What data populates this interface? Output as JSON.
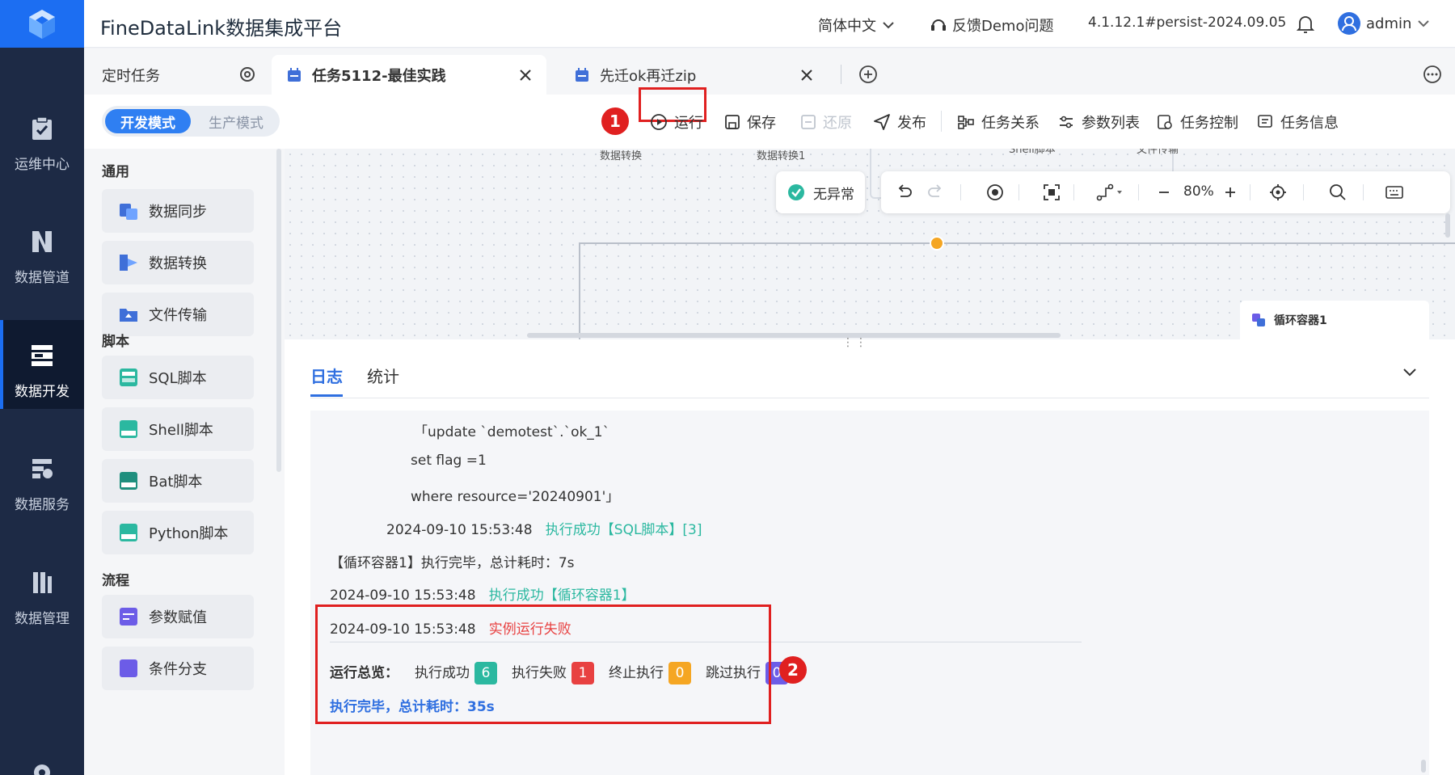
{
  "colors": {
    "nav_bg": "#1d2a45",
    "primary": "#1c6ef2",
    "success": "#2bb8a0",
    "error": "#e84141",
    "warn": "#f5a623",
    "purple": "#6c5ce7",
    "highlight": "#e02020"
  },
  "nav": {
    "items": [
      {
        "label": "运维中心",
        "icon": "clipboard-check-icon"
      },
      {
        "label": "数据管道",
        "icon": "pipeline-icon"
      },
      {
        "label": "数据开发",
        "icon": "dev-stack-icon"
      },
      {
        "label": "数据服务",
        "icon": "service-icon"
      },
      {
        "label": "数据管理",
        "icon": "manage-icon"
      }
    ]
  },
  "header": {
    "title": "FineDataLink数据集成平台",
    "language": "简体中文",
    "feedback": "反馈Demo问题",
    "version": "4.1.12.1#persist-2024.09.05",
    "user": "admin"
  },
  "tabs": {
    "scheduled": "定时任务",
    "tab1": "任务5112-最佳实践",
    "tab2": "先迁ok再迁zip"
  },
  "toolbar": {
    "mode_dev": "开发模式",
    "mode_prod": "生产模式",
    "run": "运行",
    "save": "保存",
    "restore": "还原",
    "publish": "发布",
    "relations": "任务关系",
    "params": "参数列表",
    "control": "任务控制",
    "info": "任务信息"
  },
  "sidebar": {
    "group_general": "通用",
    "group_script": "脚本",
    "group_flow": "流程",
    "items": [
      "数据同步",
      "数据转换",
      "文件传输",
      "SQL脚本",
      "Shell脚本",
      "Bat脚本",
      "Python脚本",
      "参数赋值",
      "条件分支"
    ]
  },
  "canvas": {
    "status": "无异常",
    "zoom": "80%",
    "node_labels": [
      "数据转换",
      "数据转换1",
      "Shell脚本",
      "文件传输"
    ],
    "container": "循环容器1"
  },
  "log": {
    "tab_log": "日志",
    "tab_stats": "统计",
    "sql_line1": "「update `demotest`.`ok_1`",
    "sql_line2": "set flag =1",
    "sql_line3": "where resource='20240901'」",
    "line4_time": "2024-09-10 15:53:48",
    "line4_msg": "执行成功【SQL脚本】[3]",
    "line5": "【循环容器1】执行完毕，总计耗时：7s",
    "line6_time": "2024-09-10 15:53:48",
    "line6_msg": "执行成功【循环容器1】",
    "line7_time": "2024-09-10 15:53:48",
    "line7_msg": "实例运行失败",
    "summary_label": "运行总览：",
    "success_label": "执行成功",
    "success_count": "6",
    "fail_label": "执行失败",
    "fail_count": "1",
    "stop_label": "终止执行",
    "stop_count": "0",
    "skip_label": "跳过执行",
    "skip_count": "0",
    "total": "执行完毕，总计耗时：35s"
  },
  "markers": {
    "m1": "1",
    "m2": "2"
  }
}
